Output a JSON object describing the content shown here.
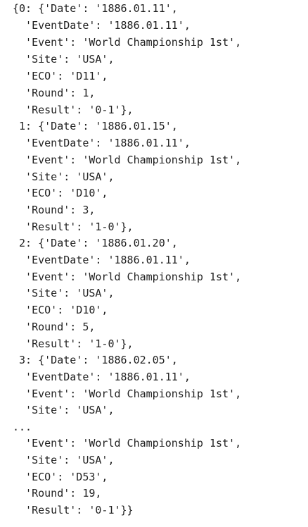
{
  "output": {
    "lines": [
      "{0: {'Date': '1886.01.11',",
      "  'EventDate': '1886.01.11',",
      "  'Event': 'World Championship 1st',",
      "  'Site': 'USA',",
      "  'ECO': 'D11',",
      "  'Round': 1,",
      "  'Result': '0-1'},",
      " 1: {'Date': '1886.01.15',",
      "  'EventDate': '1886.01.11',",
      "  'Event': 'World Championship 1st',",
      "  'Site': 'USA',",
      "  'ECO': 'D10',",
      "  'Round': 3,",
      "  'Result': '1-0'},",
      " 2: {'Date': '1886.01.20',",
      "  'EventDate': '1886.01.11',",
      "  'Event': 'World Championship 1st',",
      "  'Site': 'USA',",
      "  'ECO': 'D10',",
      "  'Round': 5,",
      "  'Result': '1-0'},",
      " 3: {'Date': '1886.02.05',",
      "  'EventDate': '1886.01.11',",
      "  'Event': 'World Championship 1st',",
      "  'Site': 'USA',",
      "...",
      "  'Event': 'World Championship 1st',",
      "  'Site': 'USA',",
      "  'ECO': 'D53',",
      "  'Round': 19,",
      "  'Result': '0-1'}}"
    ]
  }
}
